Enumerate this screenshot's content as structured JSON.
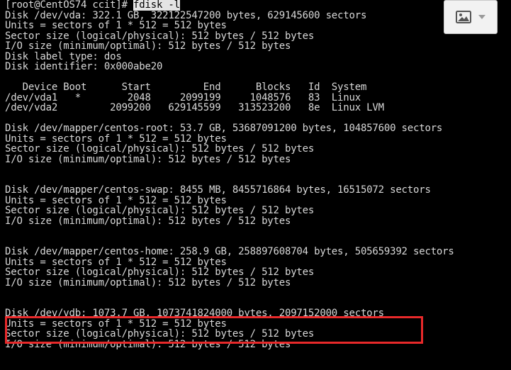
{
  "terminal": {
    "prompt": "[root@CentOS74 ccit]# ",
    "command": "fdisk -l",
    "lines": [
      "Disk /dev/vda: 322.1 GB, 322122547200 bytes, 629145600 sectors",
      "Units = sectors of 1 * 512 = 512 bytes",
      "Sector size (logical/physical): 512 bytes / 512 bytes",
      "I/O size (minimum/optimal): 512 bytes / 512 bytes",
      "Disk label type: dos",
      "Disk identifier: 0x000abe20",
      "",
      "   Device Boot      Start         End      Blocks   Id  System",
      "/dev/vda1   *        2048     2099199     1048576   83  Linux",
      "/dev/vda2         2099200   629145599   313523200   8e  Linux LVM",
      "",
      "Disk /dev/mapper/centos-root: 53.7 GB, 53687091200 bytes, 104857600 sectors",
      "Units = sectors of 1 * 512 = 512 bytes",
      "Sector size (logical/physical): 512 bytes / 512 bytes",
      "I/O size (minimum/optimal): 512 bytes / 512 bytes",
      "",
      "",
      "Disk /dev/mapper/centos-swap: 8455 MB, 8455716864 bytes, 16515072 sectors",
      "Units = sectors of 1 * 512 = 512 bytes",
      "Sector size (logical/physical): 512 bytes / 512 bytes",
      "I/O size (minimum/optimal): 512 bytes / 512 bytes",
      "",
      "",
      "Disk /dev/mapper/centos-home: 258.9 GB, 258897608704 bytes, 505659392 sectors",
      "Units = sectors of 1 * 512 = 512 bytes",
      "Sector size (logical/physical): 512 bytes / 512 bytes",
      "I/O size (minimum/optimal): 512 bytes / 512 bytes",
      "",
      "",
      "Disk /dev/vdb: 1073.7 GB, 1073741824000 bytes, 2097152000 sectors",
      "Units = sectors of 1 * 512 = 512 bytes",
      "Sector size (logical/physical): 512 bytes / 512 bytes",
      "I/O size (minimum/optimal): 512 bytes / 512 bytes"
    ]
  },
  "colors": {
    "background": "#000000",
    "text": "#d8d8d8",
    "highlight_border": "#e8292a"
  },
  "image_button": {
    "icon": "image-icon",
    "dropdown_icon": "chevron-down-icon"
  }
}
